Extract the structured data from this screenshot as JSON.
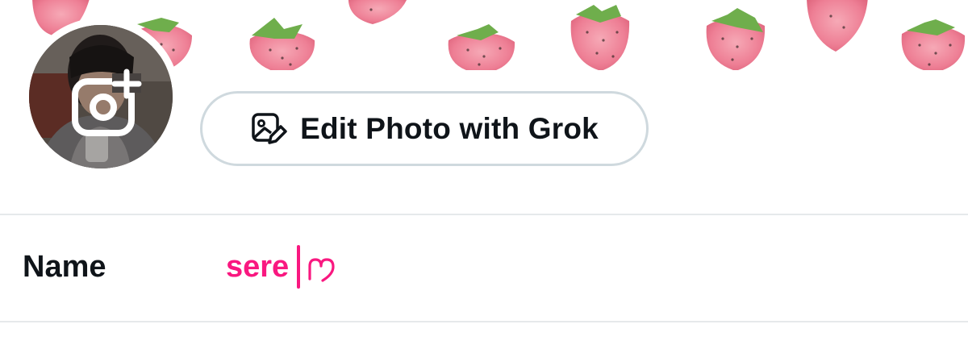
{
  "header": {
    "banner_icon": "strawberry-pattern-banner"
  },
  "avatar": {
    "overlay_icon": "camera-plus-icon"
  },
  "grok_button": {
    "icon": "image-edit-icon",
    "label": "Edit Photo with Grok"
  },
  "name_field": {
    "label": "Name",
    "value": "sere",
    "trailing_icon": "heart-outline-icon"
  },
  "colors": {
    "accent": "#f91880",
    "text": "#0f1419",
    "border": "#cfd9de",
    "divider": "#e6e9eb"
  }
}
